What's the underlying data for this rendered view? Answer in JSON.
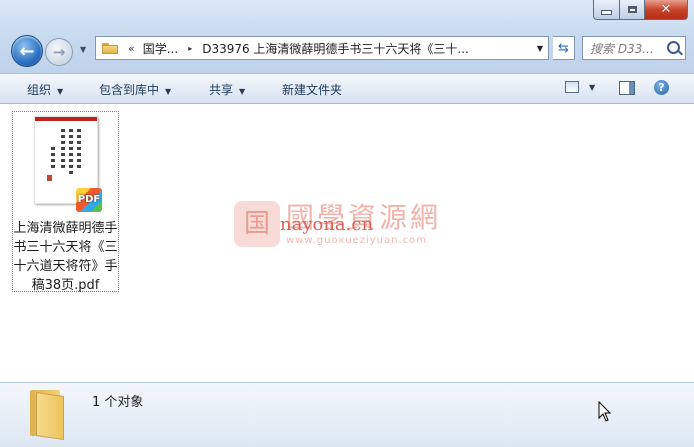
{
  "window": {
    "controls": {
      "minimize": "minimize",
      "maximize": "maximize",
      "close": "✕"
    }
  },
  "nav": {
    "back_glyph": "←",
    "forward_glyph": "→",
    "address": {
      "overflow": "«",
      "crumbs": [
        "国学...",
        "D33976 上海清微薛明德手书三十六天将《三十..."
      ],
      "separator": "▸"
    },
    "search_placeholder": "搜索 D33..."
  },
  "toolbar": {
    "organize": "组织",
    "include_in_library": "包含到库中",
    "share": "共享",
    "new_folder": "新建文件夹",
    "help": "?"
  },
  "files": [
    {
      "name": "上海清微薛明德手书三十六天将《三十六道天将符》手稿38页.pdf",
      "badge": "PDF",
      "type": "pdf"
    }
  ],
  "watermark": {
    "logo": "国",
    "cn": "國學資源網",
    "en": "nayona.cn",
    "url": "www.guoxueziyuan.com"
  },
  "details": {
    "count_text": "1 个对象"
  }
}
